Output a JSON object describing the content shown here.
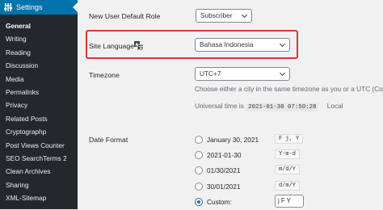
{
  "sidebar": {
    "header": "Settings",
    "items": [
      {
        "label": "General",
        "current": true
      },
      {
        "label": "Writing"
      },
      {
        "label": "Reading"
      },
      {
        "label": "Discussion"
      },
      {
        "label": "Media"
      },
      {
        "label": "Permalinks"
      },
      {
        "label": "Privacy"
      },
      {
        "label": "Related Posts"
      },
      {
        "label": "Cryptographp"
      },
      {
        "label": "Post Views Counter"
      },
      {
        "label": "SEO SearchTerms 2"
      },
      {
        "label": "Clean Archives"
      },
      {
        "label": "Sharing"
      },
      {
        "label": "XML-Sitemap"
      }
    ]
  },
  "settings": {
    "default_role": {
      "label": "New User Default Role",
      "value": "Subscriber"
    },
    "site_language": {
      "label": "Site Language",
      "value": "Bahasa Indonesia"
    },
    "timezone": {
      "label": "Timezone",
      "value": "UTC+7",
      "description": "Choose either a city in the same timezone as you or a UTC (Coo",
      "universal_prefix": "Universal time is",
      "universal_time": "2021-01-30 07:50:28",
      "local_prefix": "Local"
    },
    "date_format": {
      "label": "Date Format",
      "options": [
        {
          "label": "January 30, 2021",
          "format": "F j, Y",
          "checked": false
        },
        {
          "label": "2021-01-30",
          "format": "Y-m-d",
          "checked": false
        },
        {
          "label": "01/30/2021",
          "format": "m/d/Y",
          "checked": false
        },
        {
          "label": "30/01/2021",
          "format": "d/m/Y",
          "checked": false
        }
      ],
      "custom_label": "Custom:",
      "custom_value": "j F Y"
    }
  }
}
